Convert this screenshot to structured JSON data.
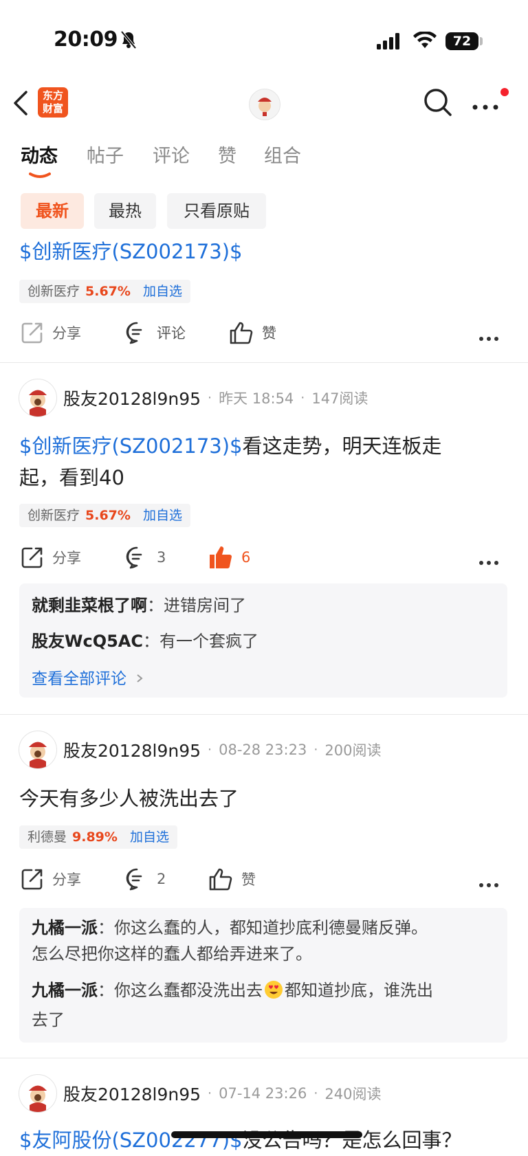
{
  "status": {
    "time": "20:09",
    "battery": "72"
  },
  "header": {
    "logo_text": "东方财富"
  },
  "tabs": [
    "动态",
    "帖子",
    "评论",
    "赞",
    "组合"
  ],
  "filters": [
    "最新",
    "最热",
    "只看原贴"
  ],
  "posts": [
    {
      "body_link": "$创新医疗(SZ002173)$",
      "body_text": "",
      "stock": {
        "name": "创新医疗",
        "pct": "5.67%",
        "add": "加自选"
      },
      "actions": {
        "share": "分享",
        "comment": "评论",
        "like": "赞"
      }
    },
    {
      "user": "股友20128l9n95",
      "time": "昨天 18:54",
      "reads": "147阅读",
      "body_link": "$创新医疗(SZ002173)$",
      "body_text_line1": "看这走势，明天连板走",
      "body_text_line2": "起，看到40",
      "stock": {
        "name": "创新医疗",
        "pct": "5.67%",
        "add": "加自选"
      },
      "actions": {
        "share": "分享",
        "comment": "3",
        "like": "6"
      },
      "comments": [
        {
          "author": "就剩韭菜根了啊",
          "text": "进错房间了"
        },
        {
          "author": "股友WcQ5AC",
          "text": "有一个套疯了"
        }
      ],
      "view_all": "查看全部评论"
    },
    {
      "user": "股友20128l9n95",
      "time": "08-28 23:23",
      "reads": "200阅读",
      "body": "今天有多少人被洗出去了",
      "stock": {
        "name": "利德曼",
        "pct": "9.89%",
        "add": "加自选"
      },
      "actions": {
        "share": "分享",
        "comment": "2",
        "like": "赞"
      },
      "comments": [
        {
          "author": "九橘一派",
          "text_line1": "你这么蠢的人，都知道抄底利德曼赌反弹。",
          "text_line2": "怎么尽把你这样的蠢人都给弄进来了。"
        },
        {
          "author": "九橘一派",
          "text_pre": "你这么蠢都没洗出去",
          "text_post": "都知道抄底，谁洗出",
          "text_line2": "去了"
        }
      ]
    },
    {
      "user": "股友20128l9n95",
      "time": "07-14 23:26",
      "reads": "240阅读",
      "body_link": "$友阿股份(SZ002277)$",
      "body_text": "没公告吗？是怎么回事？"
    }
  ],
  "colors": {
    "accent": "#f0541e",
    "link": "#1e6fd9",
    "up": "#e8471c"
  }
}
